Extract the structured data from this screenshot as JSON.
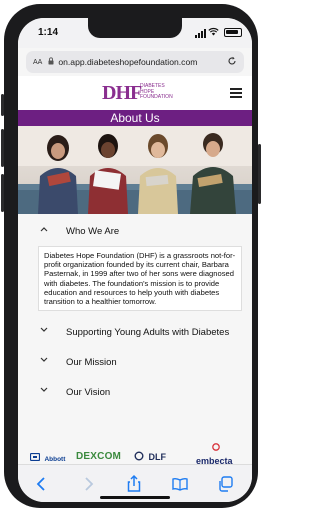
{
  "status_bar": {
    "time": "1:14"
  },
  "browser": {
    "aa_label": "AA",
    "url": "on.app.diabeteshopefoundation.com"
  },
  "site": {
    "logo_text": "DHF",
    "logo_small": [
      "DIABETES",
      "HOPE",
      "FOUNDATION"
    ],
    "page_title": "About Us"
  },
  "accordion": {
    "items": [
      {
        "label": "Who We Are",
        "expanded": true
      },
      {
        "label": "Supporting Young Adults with Diabetes",
        "expanded": false
      },
      {
        "label": "Our Mission",
        "expanded": false
      },
      {
        "label": "Our Vision",
        "expanded": false
      }
    ],
    "panel_text": "Diabetes Hope Foundation (DHF) is a grassroots not-for-profit organization founded by its current chair, Barbara Pasternak, in 1999 after two of her sons were diagnosed with diabetes. The foundation's mission is to provide education and resources to help youth with diabetes transition to a healthier tomorrow."
  },
  "partners": [
    "Abbott",
    "DEXCOM",
    "DLF",
    "embecta"
  ],
  "colors": {
    "brand_purple": "#6d1f82",
    "abbott_blue": "#0b3d91",
    "dexcom_green": "#3b8a3e",
    "dlf_navy": "#1f2d5a",
    "embecta_navy": "#1c2a6b",
    "ios_blue": "#1e7cf2"
  }
}
